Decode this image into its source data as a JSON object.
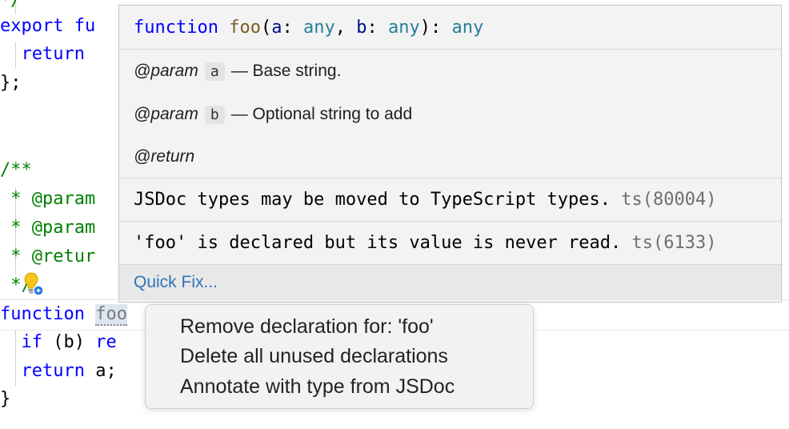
{
  "editor": {
    "lines": [
      {
        "segments": [
          {
            "t": "*/",
            "c": "cm"
          }
        ]
      },
      {
        "segments": [
          {
            "t": "export",
            "c": "kw"
          },
          {
            "t": " fu",
            "c": "kw"
          }
        ]
      },
      {
        "segments": [
          {
            "t": "  return",
            "c": "kw"
          }
        ]
      },
      {
        "segments": [
          {
            "t": "};",
            "c": ""
          }
        ]
      },
      {
        "segments": [
          {
            "t": "/**",
            "c": "cm"
          }
        ]
      },
      {
        "segments": [
          {
            "t": " * @param",
            "c": "cm"
          }
        ]
      },
      {
        "segments": [
          {
            "t": " * @param",
            "c": "cm"
          }
        ]
      },
      {
        "segments": [
          {
            "t": " * @retur",
            "c": "cm"
          }
        ]
      },
      {
        "segments": [
          {
            "t": " */",
            "c": "cm"
          }
        ]
      },
      {
        "segments": [
          {
            "t": "function",
            "c": "kw"
          }
        ]
      },
      {
        "segments": [
          {
            "t": "  if",
            "c": "kw"
          },
          {
            "t": " (b) ",
            "c": ""
          },
          {
            "t": "re",
            "c": "kw"
          }
        ]
      },
      {
        "segments": [
          {
            "t": "  return",
            "c": "kw"
          },
          {
            "t": " a;",
            "c": ""
          }
        ]
      },
      {
        "segments": [
          {
            "t": "}",
            "c": ""
          }
        ]
      }
    ],
    "foo_fragment": "foo",
    "lightbulb_icon": "lightbulb-autofix-icon"
  },
  "hover": {
    "signature": {
      "keyword": "function",
      "name": "foo",
      "open": "(",
      "param_a": "a",
      "colon1": ": ",
      "type_a": "any",
      "comma": ", ",
      "param_b": "b",
      "colon2": ": ",
      "type_b": "any",
      "close": "): ",
      "return_type": "any"
    },
    "docs": [
      {
        "tag": "@param",
        "code": "a",
        "text": "— Base string."
      },
      {
        "tag": "@param",
        "code": "b",
        "text": "— Optional string to add"
      },
      {
        "tag": "@return",
        "code": "",
        "text": ""
      }
    ],
    "diagnostics": [
      {
        "message": "JSDoc types may be moved to TypeScript types.",
        "code": "ts(80004)"
      },
      {
        "message": "'foo' is declared but its value is never read.",
        "code": "ts(6133)"
      }
    ],
    "quick_fix_label": "Quick Fix..."
  },
  "menu": {
    "items": [
      "Remove declaration for: 'foo'",
      "Delete all unused declarations",
      "Annotate with type from JSDoc"
    ]
  }
}
